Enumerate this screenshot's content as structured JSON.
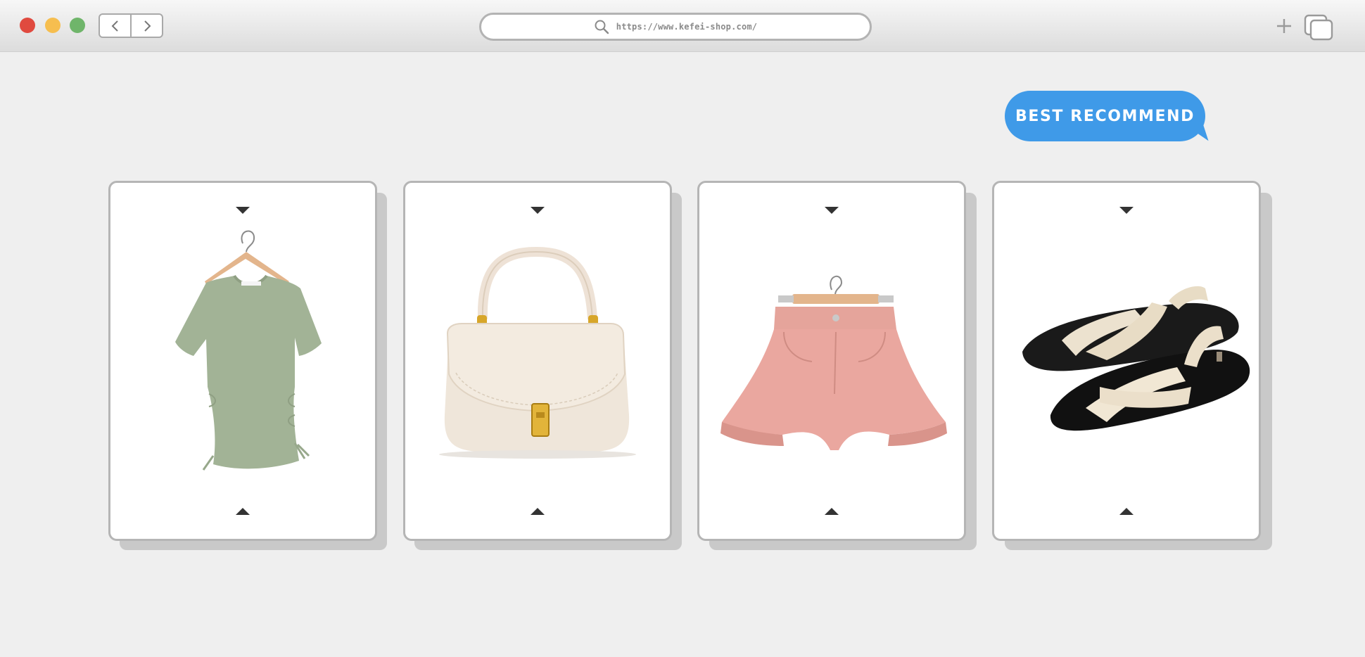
{
  "browser": {
    "url": "https://www.kefei-shop.com/",
    "icons": {
      "close": "close-dot",
      "minimize": "minimize-dot",
      "zoom": "zoom-dot",
      "back": "chevron-left-icon",
      "forward": "chevron-right-icon",
      "search": "search-icon",
      "new_tab": "plus-icon",
      "tabs": "tabs-overview-icon"
    },
    "colors": {
      "close": "#e04a3f",
      "minimize": "#f6be4f",
      "zoom": "#6fb56a"
    }
  },
  "badge": {
    "label": "BEST RECOMMEND",
    "color": "#3f9ae8"
  },
  "products": [
    {
      "name": "green-ruched-tshirt",
      "image": "green t-shirt on hanger"
    },
    {
      "name": "cream-top-handle-bag",
      "image": "cream handbag with gold clasp"
    },
    {
      "name": "pink-denim-shorts",
      "image": "pink shorts on hanger"
    },
    {
      "name": "cream-cross-strap-sandals",
      "image": "cream and black sandals"
    }
  ]
}
